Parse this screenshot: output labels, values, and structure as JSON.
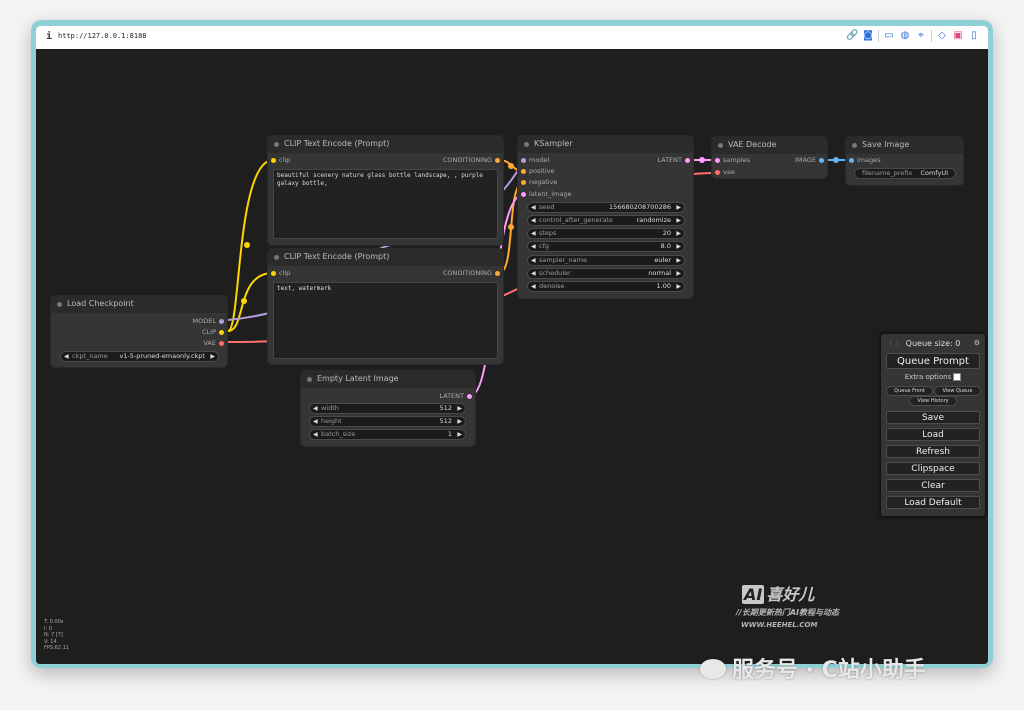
{
  "browser": {
    "info_icon": "i",
    "url": "http://127.0.0.1:8188",
    "toolbar_icons": [
      "link-icon",
      "camera-icon",
      "window-icon",
      "globe-icon",
      "crosshair-icon",
      "code-icon",
      "qr-icon",
      "sidebar-icon"
    ]
  },
  "colors": {
    "clip": "#ffd500",
    "conditioning": "#ffa931",
    "model": "#b39ddb",
    "latent": "#ff9cf9",
    "vae": "#ff6e6e",
    "image": "#64b5f6"
  },
  "nodes": {
    "load_checkpoint": {
      "title": "Load Checkpoint",
      "outputs": [
        "MODEL",
        "CLIP",
        "VAE"
      ],
      "ckpt_label": "ckpt_name",
      "ckpt_value": "v1-5-pruned-emaonly.ckpt"
    },
    "clip_pos": {
      "title": "CLIP Text Encode (Prompt)",
      "input": "clip",
      "output": "CONDITIONING",
      "text": "beautiful scenery nature glass bottle landscape, , purple galaxy bottle,"
    },
    "clip_neg": {
      "title": "CLIP Text Encode (Prompt)",
      "input": "clip",
      "output": "CONDITIONING",
      "text": "text, watermark"
    },
    "empty_latent": {
      "title": "Empty Latent Image",
      "output": "LATENT",
      "widgets": [
        {
          "label": "width",
          "value": "512"
        },
        {
          "label": "height",
          "value": "512"
        },
        {
          "label": "batch_size",
          "value": "1"
        }
      ]
    },
    "ksampler": {
      "title": "KSampler",
      "inputs": [
        "model",
        "positive",
        "negative",
        "latent_image"
      ],
      "output": "LATENT",
      "widgets": [
        {
          "label": "seed",
          "value": "156680208700286"
        },
        {
          "label": "control_after_generate",
          "value": "randomize"
        },
        {
          "label": "steps",
          "value": "20"
        },
        {
          "label": "cfg",
          "value": "8.0"
        },
        {
          "label": "sampler_name",
          "value": "euler"
        },
        {
          "label": "scheduler",
          "value": "normal"
        },
        {
          "label": "denoise",
          "value": "1.00"
        }
      ]
    },
    "vae_decode": {
      "title": "VAE Decode",
      "inputs": [
        "samples",
        "vae"
      ],
      "output": "IMAGE"
    },
    "save_image": {
      "title": "Save Image",
      "input": "images",
      "prefix_label": "filename_prefix",
      "prefix_value": "ComfyUI"
    }
  },
  "queue_panel": {
    "title": "Queue size: 0",
    "queue_prompt": "Queue Prompt",
    "extra_options": "Extra options",
    "queue_front": "Queue Front",
    "view_queue": "View Queue",
    "view_history": "View History",
    "save": "Save",
    "load": "Load",
    "refresh": "Refresh",
    "clipspace": "Clipspace",
    "clear": "Clear",
    "load_default": "Load Default"
  },
  "stats": [
    "T: 0.00s",
    "I: 0",
    "N: 7 [7]",
    "V: 14",
    "FPS:62.11"
  ],
  "watermark": {
    "ai": "AI",
    "brand": "喜好儿",
    "line2": "//长期更新热门AI教程与动态",
    "line3": "WWW.HEEHEL.COM",
    "outer": "服务号 · C站小助手"
  }
}
